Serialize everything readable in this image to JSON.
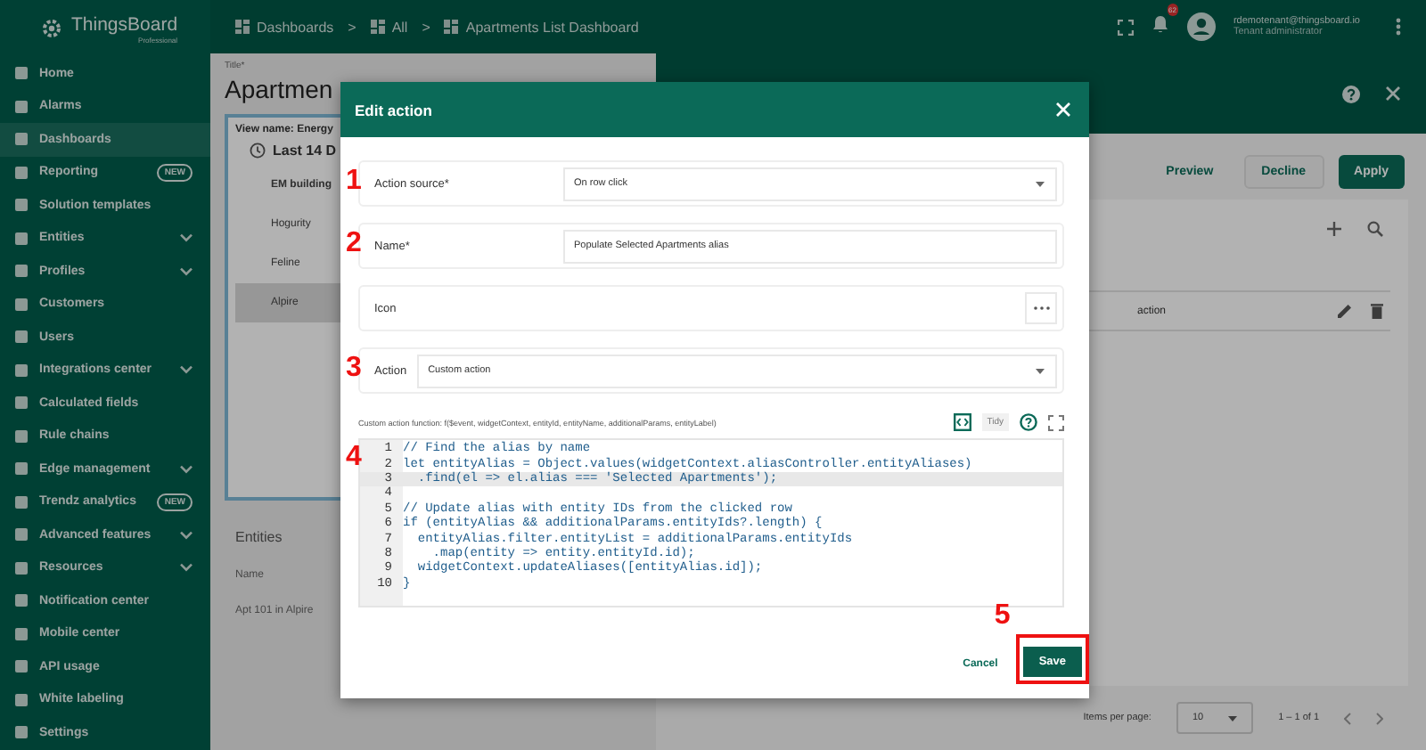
{
  "sidebar": {
    "logo": "ThingsBoard",
    "logo_sub": "Professional",
    "items": [
      {
        "label": "Home",
        "selected": false,
        "expandable": false
      },
      {
        "label": "Alarms",
        "selected": false,
        "expandable": false
      },
      {
        "label": "Dashboards",
        "selected": true,
        "expandable": false
      },
      {
        "label": "Reporting",
        "selected": false,
        "expandable": false,
        "badge": "NEW"
      },
      {
        "label": "Solution templates",
        "selected": false,
        "expandable": false
      },
      {
        "label": "Entities",
        "selected": false,
        "expandable": true
      },
      {
        "label": "Profiles",
        "selected": false,
        "expandable": true
      },
      {
        "label": "Customers",
        "selected": false,
        "expandable": false
      },
      {
        "label": "Users",
        "selected": false,
        "expandable": false
      },
      {
        "label": "Integrations center",
        "selected": false,
        "expandable": true
      },
      {
        "label": "Calculated fields",
        "selected": false,
        "expandable": false
      },
      {
        "label": "Rule chains",
        "selected": false,
        "expandable": false
      },
      {
        "label": "Edge management",
        "selected": false,
        "expandable": true
      },
      {
        "label": "Trendz analytics",
        "selected": false,
        "expandable": false,
        "badge": "NEW"
      },
      {
        "label": "Advanced features",
        "selected": false,
        "expandable": true
      },
      {
        "label": "Resources",
        "selected": false,
        "expandable": true
      },
      {
        "label": "Notification center",
        "selected": false,
        "expandable": false
      },
      {
        "label": "Mobile center",
        "selected": false,
        "expandable": false
      },
      {
        "label": "API usage",
        "selected": false,
        "expandable": false
      },
      {
        "label": "White labeling",
        "selected": false,
        "expandable": false
      },
      {
        "label": "Settings",
        "selected": false,
        "expandable": false
      }
    ]
  },
  "topbar": {
    "breadcrumbs": [
      {
        "kind": "crumb",
        "label": "Dashboards"
      },
      {
        "kind": "separator",
        "label": ">"
      },
      {
        "kind": "crumb",
        "label": "All"
      },
      {
        "kind": "separator",
        "label": ">"
      },
      {
        "kind": "crumb",
        "label": "Apartments List Dashboard"
      }
    ],
    "notifications_count": "62",
    "user": {
      "email": "rdemotenant@thingsboard.io",
      "role": "Tenant administrator"
    }
  },
  "editor": {
    "title_label": "Title*",
    "title": "Apartmen",
    "view_name": "View name: Energy",
    "time_window": "Last 14 D",
    "entity_list": [
      {
        "label": "EM building",
        "kind": "header",
        "selected": false
      },
      {
        "label": "Hogurity",
        "kind": "item",
        "selected": false
      },
      {
        "label": "Feline",
        "kind": "item",
        "selected": false
      },
      {
        "label": "Alpire",
        "kind": "item",
        "selected": true
      }
    ],
    "entities_widget": {
      "title": "Entities",
      "column": "Name",
      "rows": [
        "Apt 101 in Alpire"
      ]
    }
  },
  "actions_panel": {
    "buttons": [
      {
        "label": "Preview",
        "kind": "text"
      },
      {
        "label": "Decline",
        "kind": "outline"
      },
      {
        "label": "Apply",
        "kind": "primary"
      }
    ],
    "row_label": "action",
    "paginator": {
      "label": "Items per page:",
      "page_size": "10",
      "range": "1 – 1 of 1"
    }
  },
  "dialog": {
    "title": "Edit action",
    "fields": [
      {
        "kind": "select",
        "label": "Action source*",
        "value": "On row click",
        "marker": "1"
      },
      {
        "kind": "text",
        "label": "Name*",
        "value": "Populate Selected Apartments alias",
        "marker": "2"
      },
      {
        "kind": "icon",
        "label": "Icon"
      },
      {
        "kind": "inline-select",
        "label": "Action",
        "value": "Custom action",
        "marker": "3"
      }
    ],
    "function_label": "Custom action function: f($event, widgetContext, entityId, entityName, additionalParams, entityLabel)",
    "tidy": "Tidy",
    "code_marker": "4",
    "code": [
      {
        "n": "1",
        "text": "// Find the alias by name",
        "selected": false
      },
      {
        "n": "2",
        "text": "let entityAlias = Object.values(widgetContext.aliasController.entityAliases)",
        "selected": false
      },
      {
        "n": "3",
        "text": "  .find(el => el.alias === 'Selected Apartments');",
        "selected": true
      },
      {
        "n": "4",
        "selected": false
      },
      {
        "n": "5",
        "text": "// Update alias with entity IDs from the clicked row",
        "selected": false
      },
      {
        "n": "6",
        "text": "if (entityAlias && additionalParams.entityIds?.length) {",
        "selected": false
      },
      {
        "n": "7",
        "text": "  entityAlias.filter.entityList = additionalParams.entityIds",
        "selected": false
      },
      {
        "n": "8",
        "text": "    .map(entity => entity.entityId.id);",
        "selected": false
      },
      {
        "n": "9",
        "text": "  widgetContext.updateAliases([entityAlias.id]);",
        "selected": false
      },
      {
        "n": "10",
        "text": "}",
        "selected": false
      }
    ],
    "cancel": "Cancel",
    "save": {
      "label": "Save",
      "highlighted": true,
      "marker": "5"
    }
  }
}
